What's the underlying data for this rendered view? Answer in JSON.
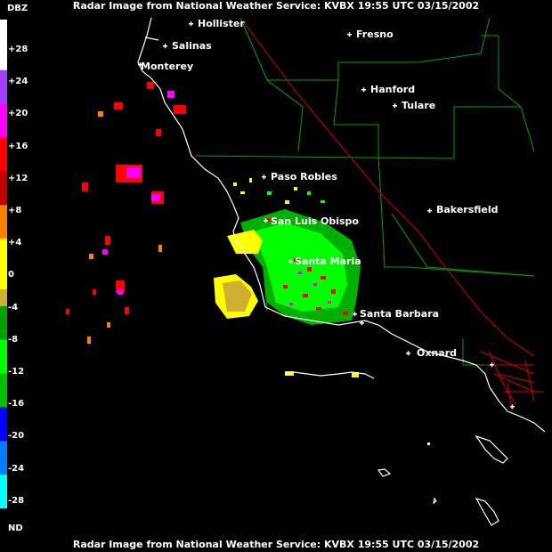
{
  "header": {
    "top": "Radar Image from National Weather Service: KVBX   19:55 UTC  03/15/2002",
    "bottom": "Radar Image from National Weather Service: KVBX   19:55 UTC  03/15/2002"
  },
  "legend": {
    "title": "DBZ",
    "nd": "ND",
    "ticks": [
      "+28",
      "+24",
      "+20",
      "+16",
      "+12",
      "+8",
      "+4",
      "0",
      "-4",
      "-8",
      "-12",
      "-16",
      "-20",
      "-24",
      "-28"
    ],
    "colors": [
      "#ffffff",
      "#ffffff",
      "#ffffff",
      "#a040ff",
      "#a040ff",
      "#ff00ff",
      "#ff00ff",
      "#ff0000",
      "#ff0000",
      "#c00000",
      "#c00000",
      "#ff8000",
      "#ff8000",
      "#ffff00",
      "#ffff00",
      "#ffff00",
      "#d0b030",
      "#00a000",
      "#00a000",
      "#00ff00",
      "#00ff00",
      "#00c000",
      "#00c000",
      "#0000ff",
      "#0000ff",
      "#0080ff",
      "#0080ff",
      "#00ffff",
      "#00ffff",
      "#000000"
    ]
  },
  "cities": [
    {
      "name": "Hollister",
      "key": "hollister"
    },
    {
      "name": "Salinas",
      "key": "salinas"
    },
    {
      "name": "Monterey",
      "key": "monterey"
    },
    {
      "name": "Fresno",
      "key": "fresno"
    },
    {
      "name": "Hanford",
      "key": "hanford"
    },
    {
      "name": "Tulare",
      "key": "tulare"
    },
    {
      "name": "Paso Robles",
      "key": "paso-robles"
    },
    {
      "name": "San Luis Obispo",
      "key": "san-luis-obispo"
    },
    {
      "name": "Bakersfield",
      "key": "bakersfield"
    },
    {
      "name": "Santa Maria",
      "key": "santa-maria"
    },
    {
      "name": "Santa Barbara",
      "key": "santa-barbara"
    },
    {
      "name": "Oxnard",
      "key": "oxnard"
    }
  ],
  "colors": {
    "coastline": "#ffffff",
    "county_lines": "#00a000",
    "highways": "#d00000",
    "background": "#000000"
  }
}
